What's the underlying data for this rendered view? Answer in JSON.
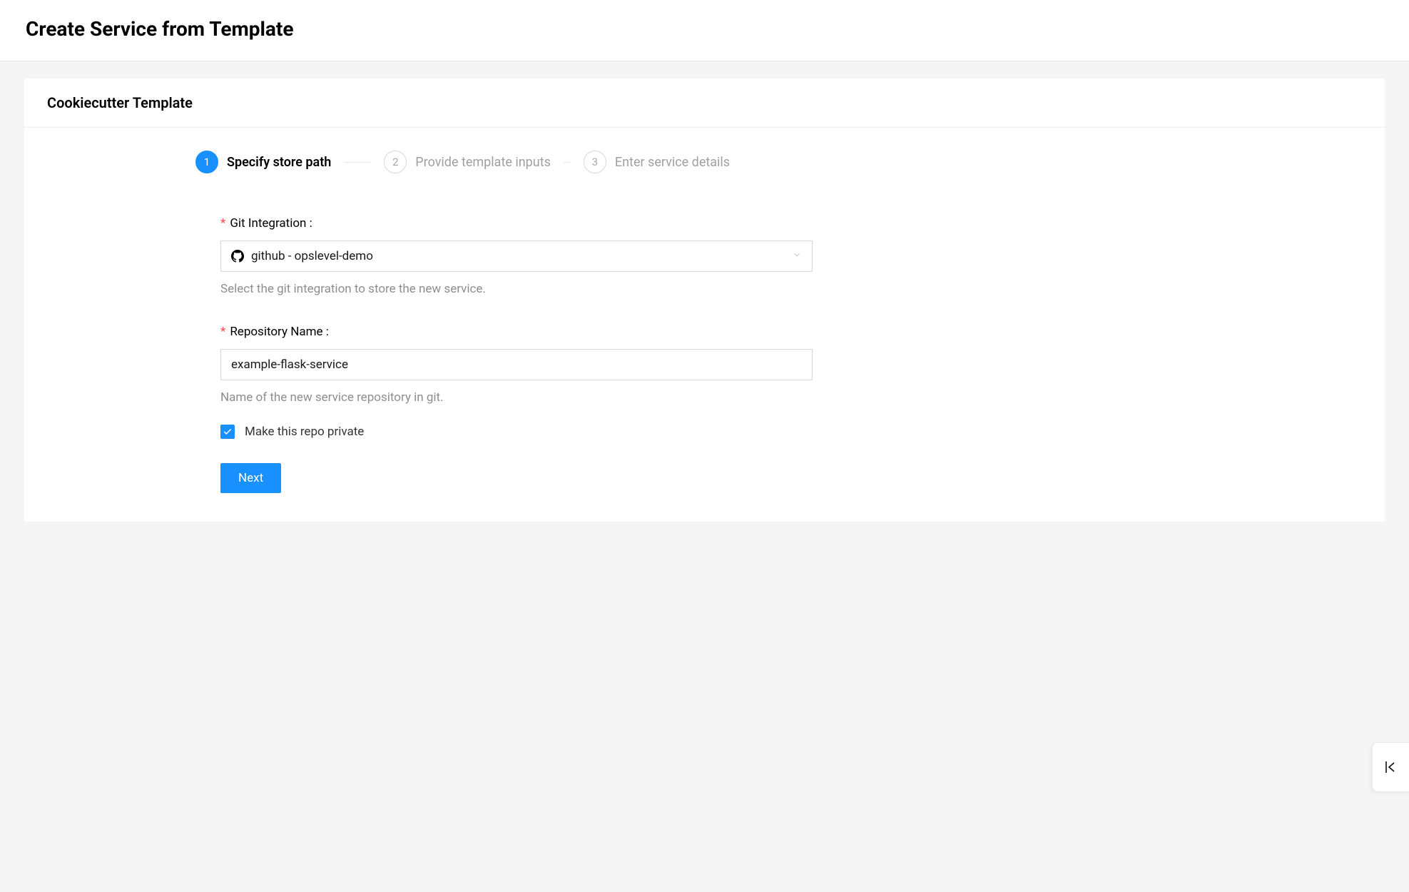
{
  "page": {
    "title": "Create Service from Template"
  },
  "card": {
    "title": "Cookiecutter Template"
  },
  "steps": [
    {
      "number": "1",
      "label": "Specify store path",
      "active": true
    },
    {
      "number": "2",
      "label": "Provide template inputs",
      "active": false
    },
    {
      "number": "3",
      "label": "Enter service details",
      "active": false
    }
  ],
  "form": {
    "gitIntegration": {
      "label": "Git Integration :",
      "value": "github - opslevel-demo",
      "help": "Select the git integration to store the new service.",
      "icon": "github-icon"
    },
    "repoName": {
      "label": "Repository Name :",
      "value": "example-flask-service",
      "help": "Name of the new service repository in git."
    },
    "private": {
      "label": "Make this repo private",
      "checked": true
    },
    "nextButton": "Next"
  }
}
